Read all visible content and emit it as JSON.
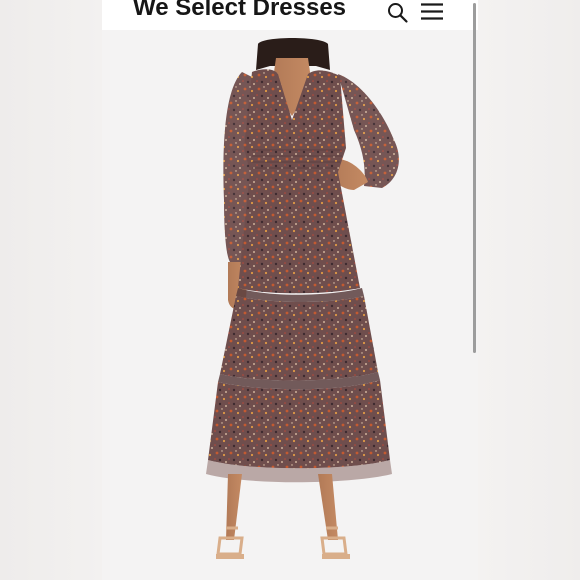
{
  "header": {
    "site_title": "We Select Dresses",
    "search_icon": "search-icon",
    "menu_icon": "hamburger-menu-icon"
  },
  "product_image": {
    "subject": "model wearing long-sleeve floral tiered maxi dress with v-neck and smocked waist, tan strappy heeled sandals",
    "dress_color": "#6e4d4c",
    "accent_colors": [
      "#c0562f",
      "#d98c3c",
      "#3b2a2e",
      "#e7c9a6"
    ],
    "sandal_color": "#d9ae8a"
  },
  "colors": {
    "page_background": "#f1efee",
    "header_background": "#ffffff",
    "title_text": "#161616"
  }
}
